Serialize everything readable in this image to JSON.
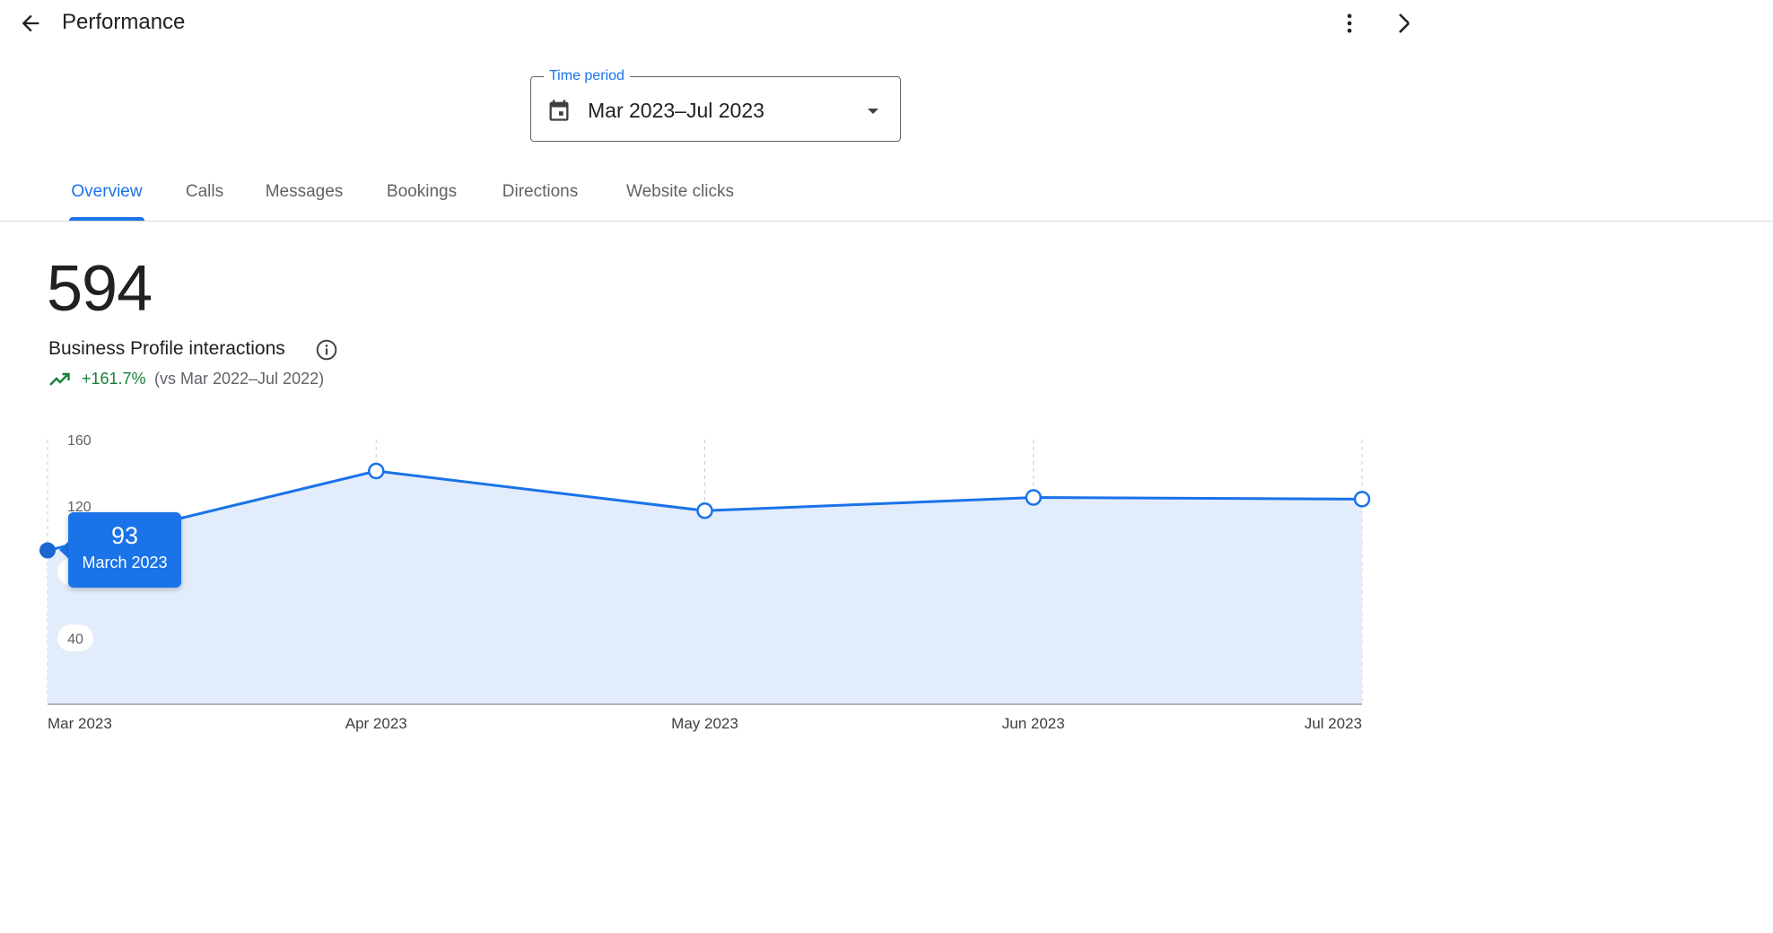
{
  "header": {
    "title": "Performance",
    "back_icon": "arrow-back-icon",
    "more_icon": "more-vert-icon",
    "close_icon": "close-icon"
  },
  "time_period": {
    "label": "Time period",
    "value": "Mar 2023–Jul 2023",
    "icon": "calendar-icon"
  },
  "tabs": [
    {
      "label": "Overview",
      "active": true
    },
    {
      "label": "Calls",
      "active": false
    },
    {
      "label": "Messages",
      "active": false
    },
    {
      "label": "Bookings",
      "active": false
    },
    {
      "label": "Directions",
      "active": false
    },
    {
      "label": "Website clicks",
      "active": false
    }
  ],
  "metric": {
    "value": "594",
    "label": "Business Profile interactions",
    "change": "+161.7%",
    "comparison": "(vs Mar 2022–Jul 2022)",
    "trend_icon": "trending-up-icon",
    "info_icon": "info-icon"
  },
  "tooltip": {
    "value": "93",
    "date": "March 2023"
  },
  "colors": {
    "accent": "#1a73e8",
    "area_fill": "#e2ecfb",
    "positive": "#188038",
    "selected_point": "#1967d2"
  },
  "chart_data": {
    "type": "area",
    "categories": [
      "Mar 2023",
      "Apr 2023",
      "May 2023",
      "Jun 2023",
      "Jul 2023"
    ],
    "values": [
      93,
      141,
      117,
      125,
      124
    ],
    "yticks": [
      "160",
      "120",
      "80",
      "40"
    ],
    "ylim": [
      0,
      160
    ],
    "selected_index": 0,
    "grid": true
  }
}
